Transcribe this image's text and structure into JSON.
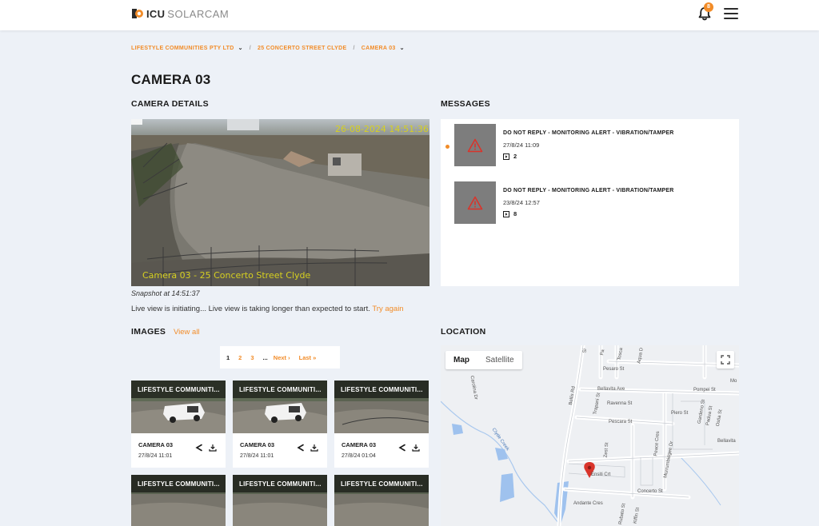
{
  "header": {
    "logo_icu": "ICU",
    "logo_solarcam": "SOLARCAM",
    "notification_count": "8"
  },
  "breadcrumb": {
    "company": "LIFESTYLE COMMUNITIES PTY LTD",
    "site": "25 CONCERTO STREET CLYDE",
    "camera": "CAMERA 03",
    "separator": "/"
  },
  "page": {
    "title": "CAMERA 03"
  },
  "camera_details": {
    "heading": "CAMERA DETAILS",
    "overlay_timestamp": "26-08-2024 14:51:36",
    "overlay_caption": "Camera 03 - 25 Concerto Street Clyde",
    "snapshot": "Snapshot at 14:51:37",
    "live_status": "Live view is initiating... Live view is taking longer than expected to start.",
    "retry_label": "Try again"
  },
  "messages": {
    "heading": "MESSAGES",
    "items": [
      {
        "title": "DO NOT REPLY - MONITORING ALERT - VIBRATION/TAMPER",
        "date": "27/8/24 11:09",
        "count": "2",
        "unread": true
      },
      {
        "title": "DO NOT REPLY - MONITORING ALERT - VIBRATION/TAMPER",
        "date": "23/8/24 12:57",
        "count": "8",
        "unread": false
      }
    ]
  },
  "images": {
    "heading": "IMAGES",
    "view_all": "View all",
    "pagination": {
      "pages": [
        "1",
        "2",
        "3"
      ],
      "current": "1",
      "ellipsis": "...",
      "next": "Next ›",
      "last": "Last »"
    },
    "cards": [
      {
        "label": "LIFESTYLE COMMUNITI...",
        "camera": "CAMERA 03",
        "date": "27/8/24 11:01"
      },
      {
        "label": "LIFESTYLE COMMUNITI...",
        "camera": "CAMERA 03",
        "date": "27/8/24 11:01"
      },
      {
        "label": "LIFESTYLE COMMUNITI...",
        "camera": "CAMERA 03",
        "date": "27/8/24 01:04"
      },
      {
        "label": "LIFESTYLE COMMUNITI..."
      },
      {
        "label": "LIFESTYLE COMMUNITI..."
      },
      {
        "label": "LIFESTYLE COMMUNITI..."
      }
    ]
  },
  "location": {
    "heading": "LOCATION",
    "map_tab": "Map",
    "satellite_tab": "Satellite",
    "streets": {
      "pesaro": "Pesaro St",
      "bellavita_ave": "Bellavita Ave",
      "ravenna": "Ravenna St",
      "pescara": "Pescara St",
      "pompei": "Pompei St",
      "piero": "Piero St",
      "bellavita": "Bellavita",
      "carolina": "Carolina Dr",
      "clyde_creek": "Clyde Creek",
      "bellis": "Bellis Rd",
      "trapani": "Trapani St",
      "zest": "Zest St",
      "peace": "Peace Cres",
      "murrumbidgee": "Murrumbidgee Dr",
      "ensiti": "Ensiti Crt",
      "concerto": "Concerto St",
      "andante": "Andante Cres",
      "rubato": "Rubato St",
      "kiffin": "Kiffin St",
      "gardeno": "Gardeno St",
      "padua": "Padua St",
      "ostia": "Ostia St",
      "mo": "Mo",
      "si": "Si",
      "pa": "Pa",
      "tosca": "Tosca",
      "aqua": "Aqua D"
    }
  },
  "colors": {
    "accent": "#f28c28",
    "background": "#edf1f7",
    "overlay_text": "#d6d020"
  }
}
